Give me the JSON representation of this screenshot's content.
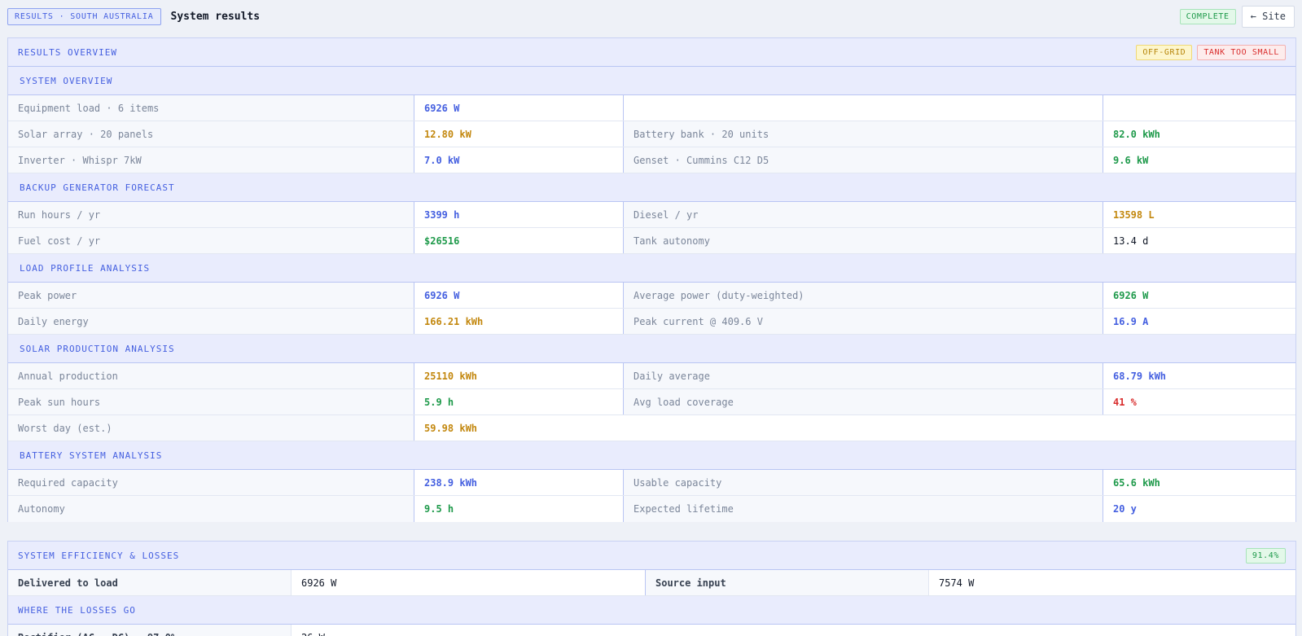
{
  "header": {
    "breadcrumb": "RESULTS · SOUTH AUSTRALIA",
    "title": "System results",
    "status": "COMPLETE",
    "back_button": "← Site"
  },
  "overview": {
    "title": "RESULTS OVERVIEW",
    "badges": [
      "OFF-GRID",
      "TANK TOO SMALL"
    ],
    "sections": {
      "system": {
        "title": "SYSTEM OVERVIEW",
        "rows": [
          {
            "l1": "Equipment load · 6 items",
            "v1": "6926 W",
            "l2": "",
            "v2": ""
          },
          {
            "l1": "Solar array · 20 panels",
            "v1": "12.80 kW",
            "l2": "Battery bank · 20 units",
            "v2": "82.0 kWh"
          },
          {
            "l1": "Inverter · Whispr 7kW",
            "v1": "7.0 kW",
            "l2": "Genset · Cummins C12 D5",
            "v2": "9.6 kW"
          }
        ]
      },
      "generator": {
        "title": "BACKUP GENERATOR FORECAST",
        "rows": [
          {
            "l1": "Run hours / yr",
            "v1": "3399 h",
            "l2": "Diesel / yr",
            "v2": "13598 L"
          },
          {
            "l1": "Fuel cost / yr",
            "v1": "$26516",
            "l2": "Tank autonomy",
            "v2": "13.4 d"
          }
        ]
      },
      "load": {
        "title": "LOAD PROFILE ANALYSIS",
        "rows": [
          {
            "l1": "Peak power",
            "v1": "6926 W",
            "l2": "Average power (duty-weighted)",
            "v2": "6926 W"
          },
          {
            "l1": "Daily energy",
            "v1": "166.21 kWh",
            "l2": "Peak current @ 409.6 V",
            "v2": "16.9 A"
          }
        ]
      },
      "solar": {
        "title": "SOLAR PRODUCTION ANALYSIS",
        "rows": [
          {
            "l1": "Annual production",
            "v1": "25110 kWh",
            "l2": "Daily average",
            "v2": "68.79 kWh"
          },
          {
            "l1": "Peak sun hours",
            "v1": "5.9 h",
            "l2": "Avg load coverage",
            "v2": "41 %"
          }
        ],
        "worst_label": "Worst day (est.)",
        "worst_value": "59.98 kWh"
      },
      "battery": {
        "title": "BATTERY SYSTEM ANALYSIS",
        "rows": [
          {
            "l1": "Required capacity",
            "v1": "238.9 kWh",
            "l2": "Usable capacity",
            "v2": "65.6 kWh"
          },
          {
            "l1": "Autonomy",
            "v1": "9.5 h",
            "l2": "Expected lifetime",
            "v2": "20 y"
          }
        ]
      }
    }
  },
  "efficiency": {
    "title": "SYSTEM EFFICIENCY & LOSSES",
    "badge": "91.4%",
    "delivered_label": "Delivered to load",
    "delivered_value": "6926 W",
    "source_label": "Source input",
    "source_value": "7574 W",
    "losses_title": "WHERE THE LOSSES GO",
    "loss_rows": [
      {
        "label": "Rectifier (AC → DC) · 97.0%",
        "value": "26 W"
      }
    ]
  },
  "colors": {
    "accent": "#4560e0",
    "orange": "#c3880f",
    "green": "#1f9a4b",
    "red": "#d92e2e"
  }
}
